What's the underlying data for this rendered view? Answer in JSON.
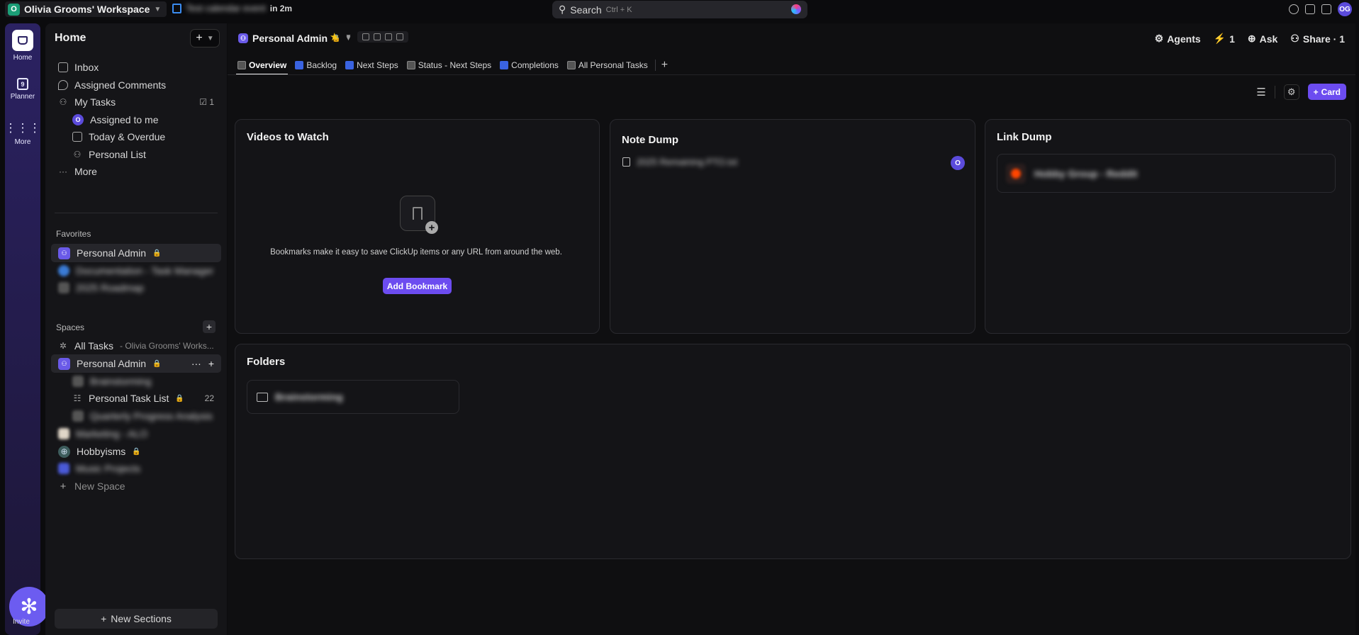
{
  "topbar": {
    "workspace_initial": "O",
    "workspace_name": "Olivia Grooms' Workspace",
    "calendar_event": "Test calendar event",
    "calendar_time": "in 2m",
    "search_label": "Search",
    "search_hint": "Ctrl + K",
    "avatar_initials": "OG"
  },
  "rail": {
    "home": "Home",
    "planner": "Planner",
    "planner_day": "9",
    "more": "More",
    "invite": "Invite"
  },
  "sidebar": {
    "title": "Home",
    "nav": [
      {
        "label": "Inbox"
      },
      {
        "label": "Assigned Comments"
      },
      {
        "label": "My Tasks",
        "count": "1"
      },
      {
        "label": "Assigned to me"
      },
      {
        "label": "Today & Overdue"
      },
      {
        "label": "Personal List"
      },
      {
        "label": "More"
      }
    ],
    "favorites_heading": "Favorites",
    "favorites": [
      {
        "label": "Personal Admin"
      },
      {
        "label": "Documentation - Task Manager"
      },
      {
        "label": "2025 Roadmap"
      }
    ],
    "spaces_heading": "Spaces",
    "all_tasks_label": "All Tasks",
    "all_tasks_sub": "- Olivia Grooms' Works...",
    "spaces": [
      {
        "label": "Personal Admin"
      },
      {
        "label": "Brainstorming"
      },
      {
        "label": "Personal Task List",
        "count": "22"
      },
      {
        "label": "Quarterly Progress Analysis"
      },
      {
        "label": "Marketing - ALO"
      },
      {
        "label": "Hobbyisms"
      },
      {
        "label": "Music Projects"
      }
    ],
    "new_space": "New Space",
    "new_sections": "New Sections"
  },
  "header": {
    "breadcrumb": "Personal Admin",
    "agents": "Agents",
    "bolt_count": "1",
    "ask": "Ask",
    "share": "Share · 1"
  },
  "tabs": [
    {
      "label": "Overview",
      "active": true
    },
    {
      "label": "Backlog"
    },
    {
      "label": "Next Steps"
    },
    {
      "label": "Status - Next Steps"
    },
    {
      "label": "Completions"
    },
    {
      "label": "All Personal Tasks"
    }
  ],
  "toolbar": {
    "card_label": "Card"
  },
  "cards": {
    "videos": {
      "title": "Videos to Watch",
      "empty_text": "Bookmarks make it easy to save ClickUp items or any URL from around the web.",
      "button": "Add Bookmark"
    },
    "notes": {
      "title": "Note Dump",
      "item": "2025 Remaining PTO.txt",
      "item_avatar": "O"
    },
    "links": {
      "title": "Link Dump",
      "item": "Hobby Group - Reddit"
    },
    "folders": {
      "title": "Folders",
      "item": "Brainstorming"
    }
  },
  "colors": {
    "accent": "#6c4cf0",
    "rail": "#2b2262",
    "workspace_logo": "#1b9e77"
  }
}
